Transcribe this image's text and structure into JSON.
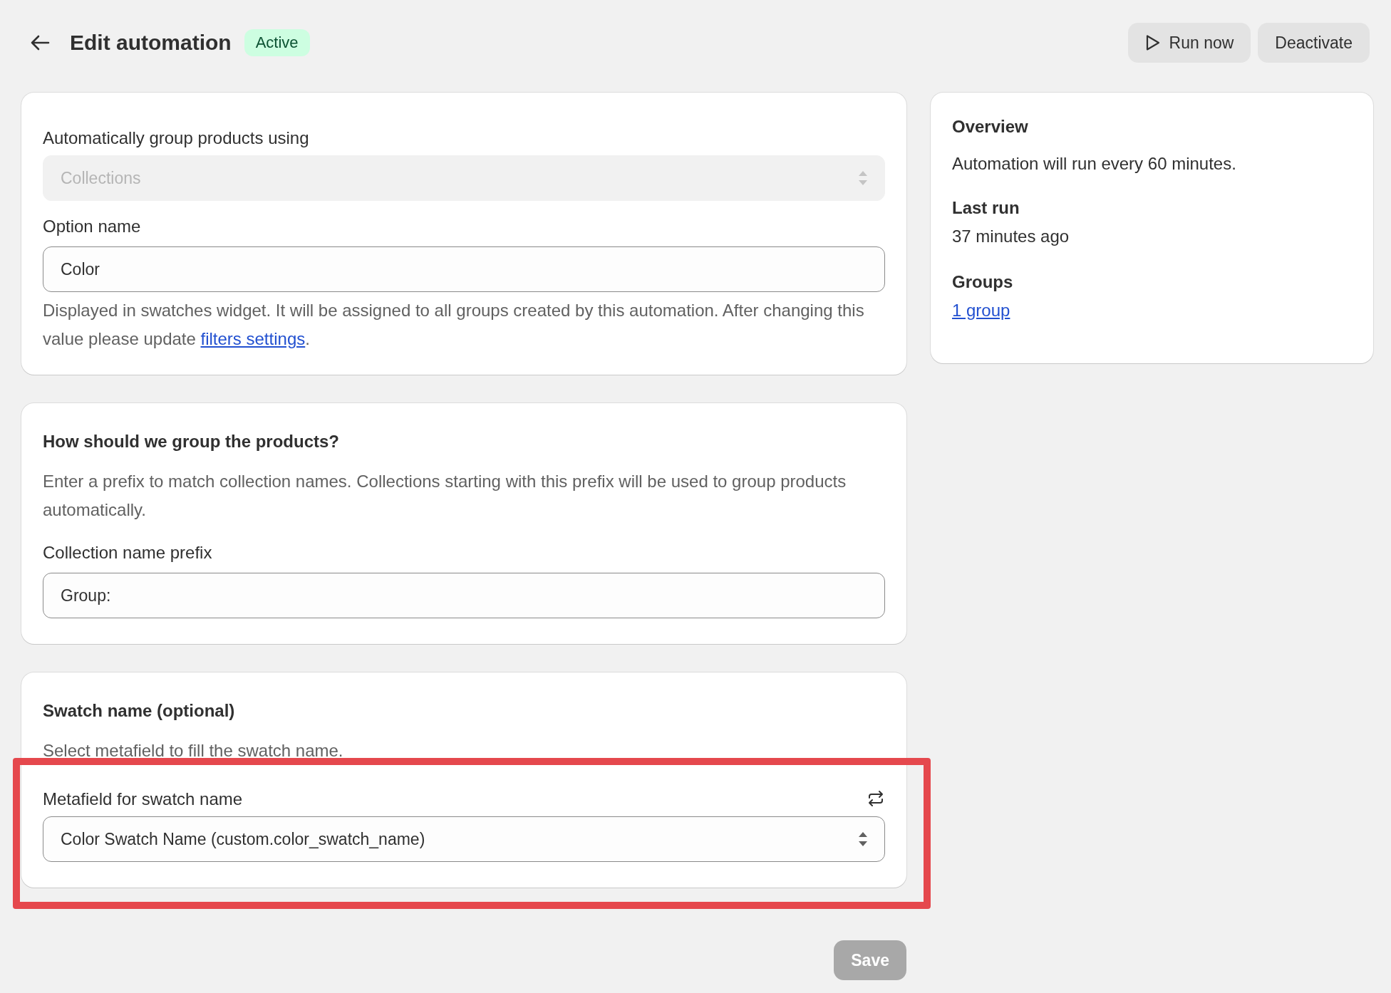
{
  "header": {
    "title": "Edit automation",
    "status": "Active",
    "actions": [
      {
        "label": "Run now",
        "kind": "run"
      },
      {
        "label": "Deactivate",
        "kind": "plain"
      }
    ]
  },
  "cards": [
    {
      "highlighted": false,
      "blocks": [
        {
          "kind": "select",
          "label": "Automatically group products using",
          "value": "Collections",
          "disabled": true,
          "refresh": false
        },
        {
          "kind": "text",
          "label": "Option name",
          "value": "Color",
          "help": "Displayed in swatches widget. It will be assigned to all groups created by this automation. After changing this value please update ",
          "help_link": "filters settings",
          "help_end": "."
        }
      ]
    },
    {
      "highlighted": false,
      "blocks": [
        {
          "kind": "heading",
          "text": "How should we group the products?"
        },
        {
          "kind": "paragraph",
          "text": "Enter a prefix to match collection names. Collections starting with this prefix will be used to group products automatically."
        },
        {
          "kind": "text",
          "label": "Collection name prefix",
          "value": "Group:"
        }
      ]
    },
    {
      "highlighted": true,
      "blocks": [
        {
          "kind": "heading",
          "text": "Swatch name (optional)"
        },
        {
          "kind": "paragraph",
          "text": "Select metafield to fill the swatch name."
        },
        {
          "kind": "select",
          "label": "Metafield for swatch name",
          "value": "Color Swatch Name (custom.color_swatch_name)",
          "disabled": false,
          "refresh": true
        }
      ]
    }
  ],
  "overview": {
    "title": "Overview",
    "text": "Automation will run every 60 minutes.",
    "sections": [
      {
        "title": "Last run",
        "value": "37 minutes ago",
        "link": false
      },
      {
        "title": "Groups",
        "value": "1 group",
        "link": true
      }
    ]
  },
  "save": {
    "label": "Save",
    "disabled": true
  }
}
